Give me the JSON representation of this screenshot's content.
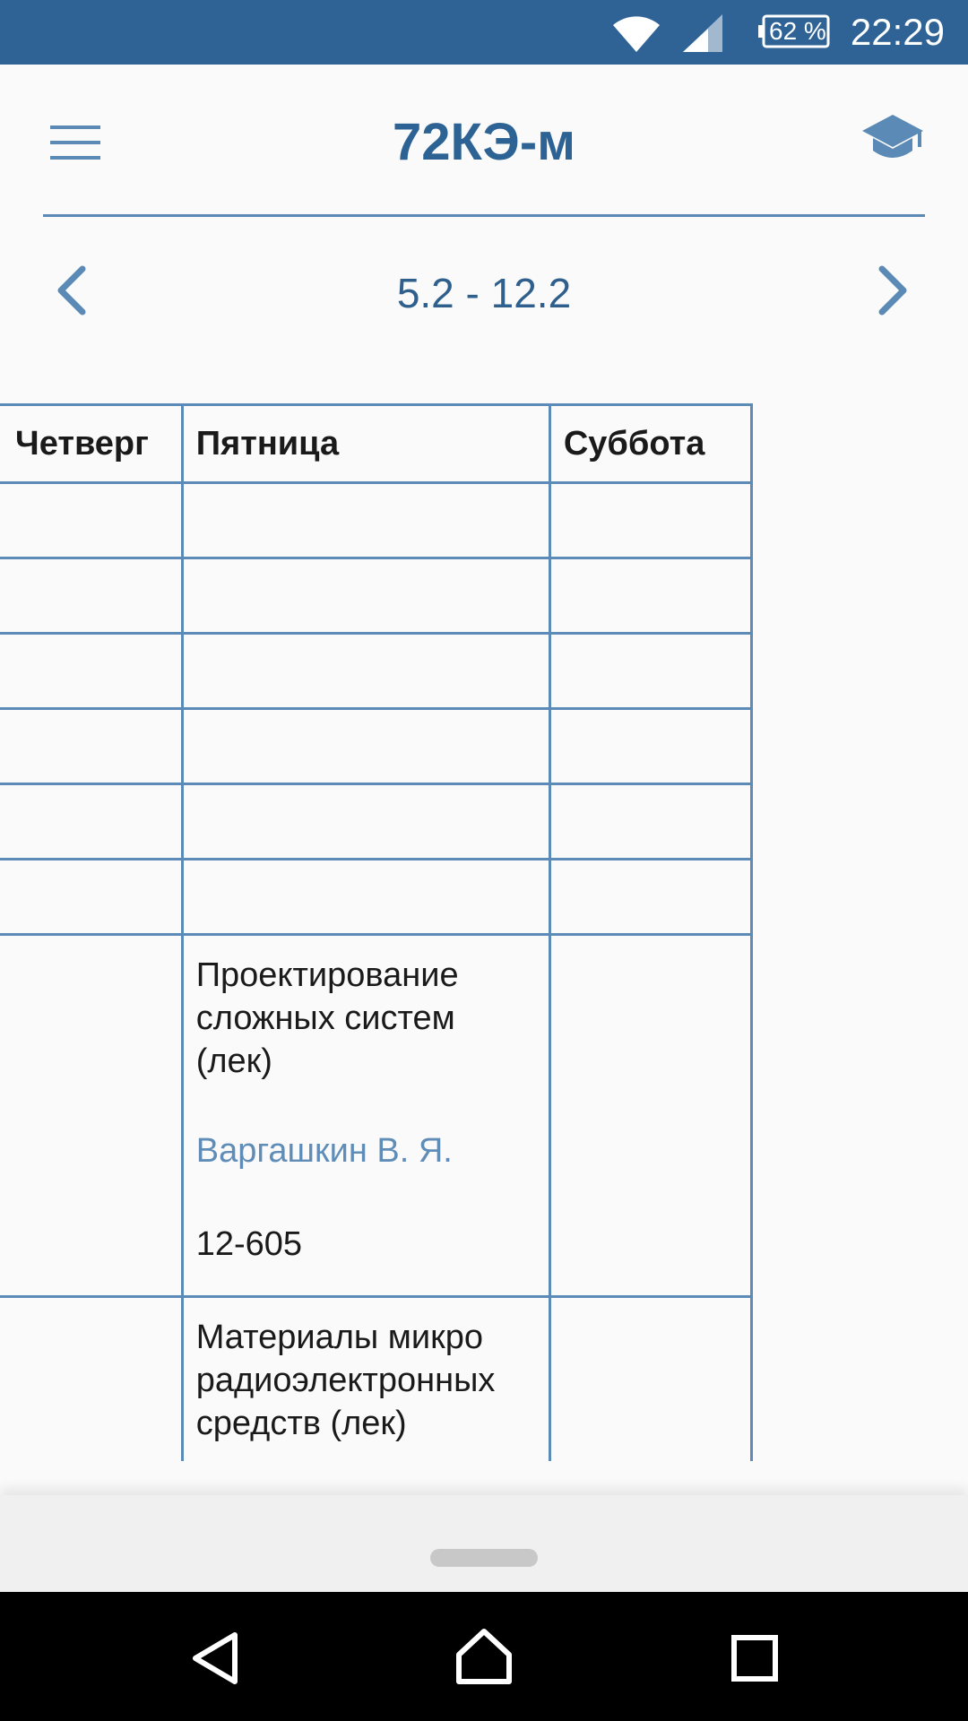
{
  "status_bar": {
    "time": "22:29",
    "battery": "62 %"
  },
  "app_bar": {
    "title": "72КЭ-м",
    "menu_icon": "hamburger-menu-icon",
    "right_icon": "graduation-cap-icon",
    "accent_color": "#2c6394"
  },
  "week_nav": {
    "range": "5.2 - 12.2",
    "prev_icon": "chevron-left-icon",
    "next_icon": "chevron-right-icon"
  },
  "schedule": {
    "headers": [
      "Четверг",
      "Пятница",
      "Суббота"
    ],
    "lessons": [
      {
        "subject": "Проектирование сложных систем (лек)",
        "teacher": "Варгашкин В. Я.",
        "room": "12-605"
      },
      {
        "subject": "Материалы микро радиоэлектронных средств (лек)"
      }
    ]
  },
  "nav_bar": {
    "back_icon": "back-triangle-icon",
    "home_icon": "home-icon",
    "recents_icon": "recents-square-icon"
  }
}
